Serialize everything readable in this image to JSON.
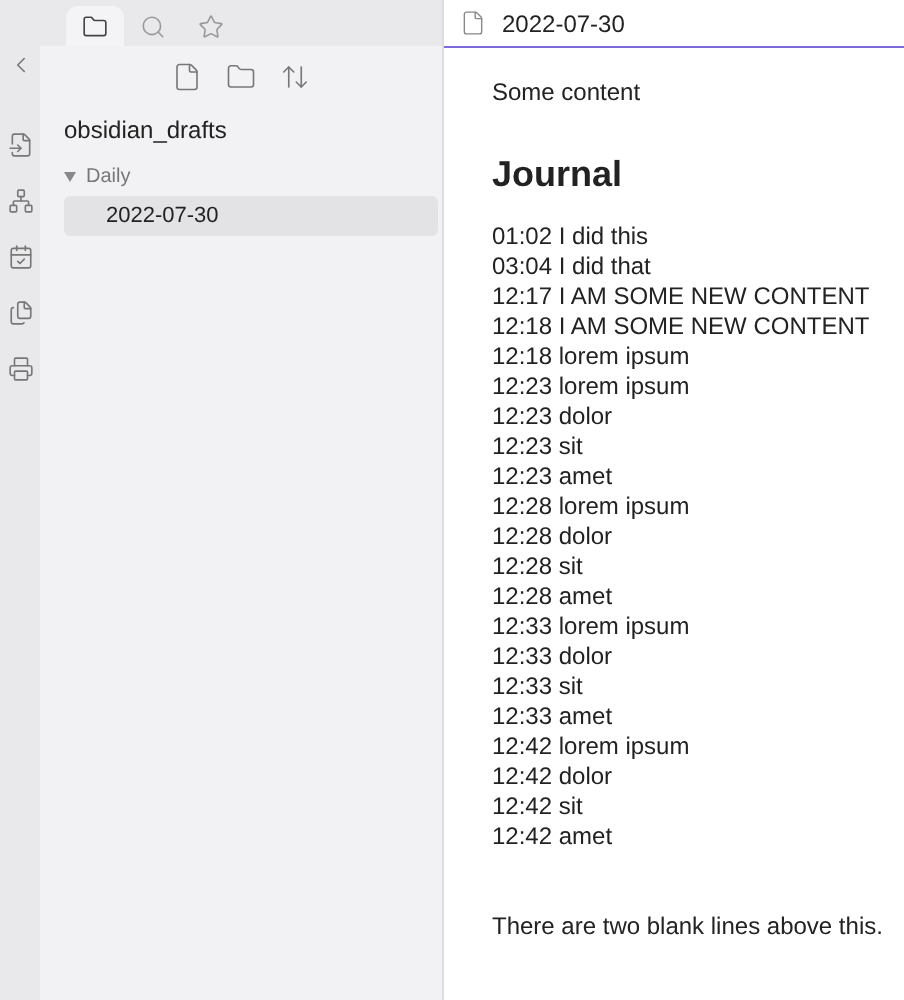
{
  "sidebar": {
    "tabs": [
      {
        "kind": "files",
        "selected": true
      },
      {
        "kind": "search",
        "selected": false
      },
      {
        "kind": "bookmarks",
        "selected": false
      }
    ],
    "vault": "obsidian_drafts",
    "tree": [
      {
        "label": "Daily",
        "expanded": true,
        "selected": false,
        "children": [
          {
            "label": "2022-07-30",
            "selected": true
          }
        ]
      }
    ]
  },
  "editor": {
    "title": "2022-07-30",
    "content": [
      {
        "kind": "paragraph",
        "text": "Some content"
      },
      {
        "kind": "heading",
        "text": "Journal"
      },
      {
        "kind": "line",
        "text": "01:02 I did this"
      },
      {
        "kind": "line",
        "text": "03:04 I did that"
      },
      {
        "kind": "line",
        "text": "12:17 I AM SOME NEW CONTENT"
      },
      {
        "kind": "line",
        "text": "12:18 I AM SOME NEW CONTENT"
      },
      {
        "kind": "line",
        "text": "12:18 lorem ipsum"
      },
      {
        "kind": "line",
        "text": "12:23 lorem ipsum"
      },
      {
        "kind": "line",
        "text": "12:23 dolor"
      },
      {
        "kind": "line",
        "text": "12:23 sit"
      },
      {
        "kind": "line",
        "text": "12:23 amet"
      },
      {
        "kind": "line",
        "text": "12:28 lorem ipsum"
      },
      {
        "kind": "line",
        "text": "12:28 dolor"
      },
      {
        "kind": "line",
        "text": "12:28 sit"
      },
      {
        "kind": "line",
        "text": "12:28 amet"
      },
      {
        "kind": "line",
        "text": "12:33 lorem ipsum"
      },
      {
        "kind": "line",
        "text": "12:33 dolor"
      },
      {
        "kind": "line",
        "text": "12:33 sit"
      },
      {
        "kind": "line",
        "text": "12:33 amet"
      },
      {
        "kind": "line",
        "text": "12:42 lorem ipsum"
      },
      {
        "kind": "line",
        "text": "12:42 dolor"
      },
      {
        "kind": "line",
        "text": "12:42 sit"
      },
      {
        "kind": "line",
        "text": "12:42 amet"
      },
      {
        "kind": "blank"
      },
      {
        "kind": "blank"
      },
      {
        "kind": "line",
        "text": "There are two blank lines above this."
      }
    ]
  }
}
